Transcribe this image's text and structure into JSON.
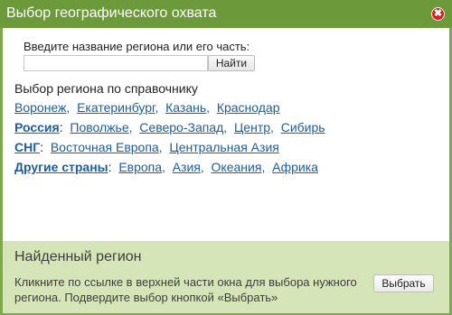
{
  "dialog": {
    "title": "Выбор географического охвата",
    "close_glyph": "✖"
  },
  "search": {
    "label": "Введите название региона или его часть:",
    "value": "",
    "placeholder": "",
    "button_label": "Найти"
  },
  "directory": {
    "heading": "Выбор региона по справочнику",
    "rows": [
      {
        "group": null,
        "items": [
          "Воронеж",
          "Екатеринбург",
          "Казань",
          "Краснодар"
        ]
      },
      {
        "group": "Россия",
        "items": [
          "Поволжье",
          "Северо-Запад",
          "Центр",
          "Сибирь"
        ]
      },
      {
        "group": "СНГ",
        "items": [
          "Восточная Европа",
          "Центральная Азия"
        ]
      },
      {
        "group": "Другие страны",
        "items": [
          "Европа",
          "Азия",
          "Океания",
          "Африка"
        ]
      }
    ]
  },
  "footer": {
    "title": "Найденный регион",
    "text": "Кликните по ссылке в верхней части окна для выбора нужного региона. Подвердите выбор кнопкой «Выбрать»",
    "button_label": "Выбрать"
  },
  "colors": {
    "titlebar": "#6c9a3a",
    "link": "#1a5fa0",
    "footer_bg": "#d6e5b8",
    "close": "#d81e1e"
  },
  "icons": {
    "close": "close-icon"
  }
}
